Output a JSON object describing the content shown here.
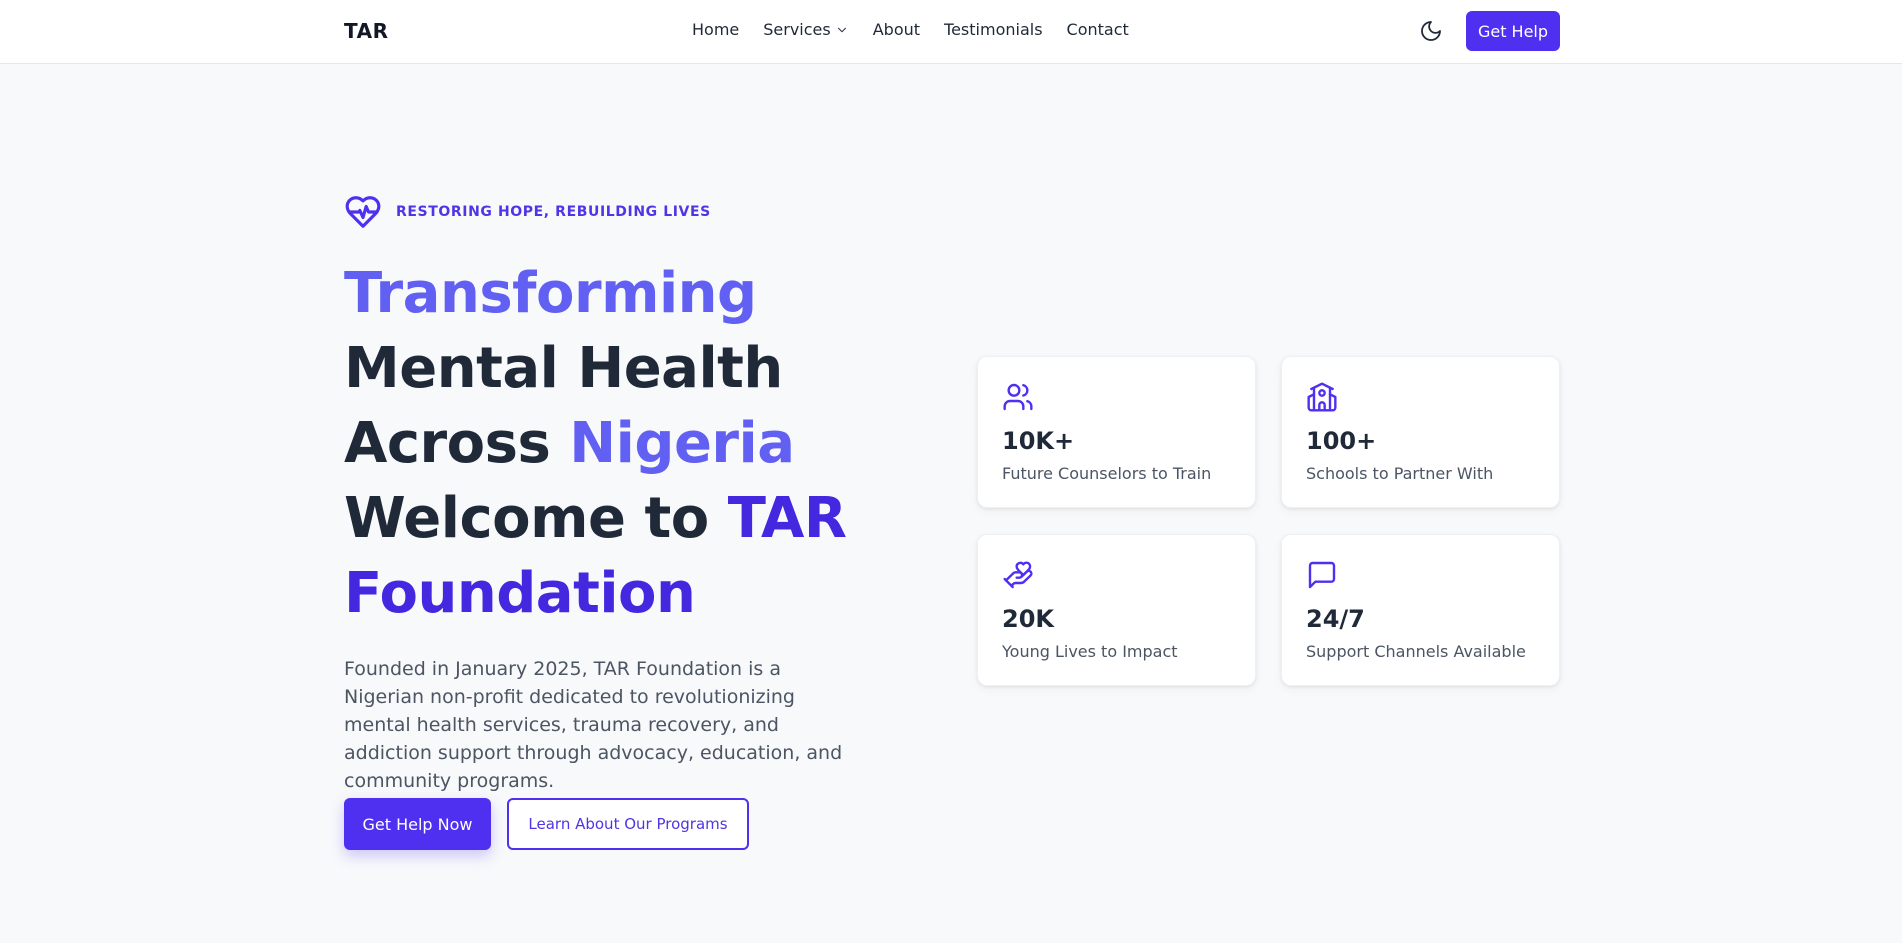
{
  "nav": {
    "logo": "TAR",
    "items": [
      "Home",
      "Services",
      "About",
      "Testimonials",
      "Contact"
    ],
    "cta": "Get Help"
  },
  "hero": {
    "tagline": "RESTORING HOPE, REBUILDING LIVES",
    "headline": {
      "w1": "Transforming",
      "w2": "Mental Health",
      "w3": "Across",
      "w4": "Nigeria",
      "w5": "Welcome to",
      "w6": "TAR",
      "w7": "Foundation"
    },
    "lead": "Founded in January 2025, TAR Foundation is a Nigerian non-profit dedicated to revolutionizing mental health services, trauma recovery, and addiction support through advocacy, education, and community programs.",
    "primary_btn": "Get Help Now",
    "secondary_btn": "Learn About Our Programs"
  },
  "stats": [
    {
      "value": "10K+",
      "label": "Future Counselors to Train",
      "icon": "users-icon"
    },
    {
      "value": "100+",
      "label": "Schools to Partner With",
      "icon": "school-icon"
    },
    {
      "value": "20K",
      "label": "Young Lives to Impact",
      "icon": "hand-heart-icon"
    },
    {
      "value": "24/7",
      "label": "Support Channels Available",
      "icon": "chat-icon"
    }
  ],
  "colors": {
    "accent": "#4f2ff0",
    "accent_light": "#6160f2",
    "accent_dark": "#4328e0",
    "text_dark": "#1f2937",
    "background": "#f8f9fb"
  }
}
